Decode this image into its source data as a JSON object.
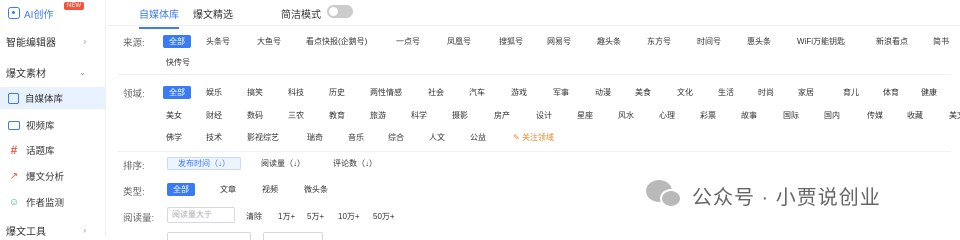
{
  "sidebar": {
    "top": {
      "label": "AI创作",
      "badge": "NEW"
    },
    "groups": [
      {
        "label": "智能编辑器"
      },
      {
        "label": "爆文素材"
      },
      {
        "label": "爆文工具"
      }
    ],
    "items": [
      {
        "label": "自媒体库",
        "icon": "media-library-icon",
        "active": true
      },
      {
        "label": "视频库",
        "icon": "video-icon"
      },
      {
        "label": "话题库",
        "icon": "hash-icon"
      },
      {
        "label": "爆文分析",
        "icon": "trend-chart-icon"
      },
      {
        "label": "作者监测",
        "icon": "user-add-icon"
      }
    ]
  },
  "tabs": [
    {
      "label": "自媒体库",
      "active": true
    },
    {
      "label": "爆文精选"
    }
  ],
  "simple_mode": {
    "label": "简洁模式",
    "on": false
  },
  "filters": {
    "source": {
      "label": "来源:",
      "row1": [
        "全部",
        "头条号",
        "大鱼号",
        "看点快报(企鹅号)",
        "一点号",
        "凤凰号",
        "搜狐号",
        "网易号",
        "趣头条",
        "东方号",
        "时间号",
        "惠头条",
        "WiFi万能钥匙",
        "新浪看点",
        "简书"
      ],
      "row2": [
        "快传号"
      ]
    },
    "domain": {
      "label": "领域:",
      "row1": [
        "全部",
        "娱乐",
        "搞笑",
        "科技",
        "历史",
        "两性情感",
        "社会",
        "汽车",
        "游戏",
        "军事",
        "动漫",
        "美食",
        "文化",
        "生活",
        "时尚",
        "家居",
        "育儿",
        "体育",
        "健康"
      ],
      "row2": [
        "美女",
        "财经",
        "数码",
        "三农",
        "教育",
        "旅游",
        "科学",
        "摄影",
        "房产",
        "设计",
        "星座",
        "风水",
        "心理",
        "彩票",
        "故事",
        "国际",
        "国内",
        "传媒",
        "收藏",
        "美文"
      ],
      "row3": [
        "佛学",
        "技术",
        "影视综艺",
        "瑞奇",
        "音乐",
        "综合",
        "人文",
        "公益"
      ],
      "follow": "关注领域"
    },
    "sort": {
      "label": "排序:",
      "options": [
        "发布时间（↓）",
        "阅读量（↓）",
        "评论数（↓）"
      ]
    },
    "type": {
      "label": "类型:",
      "options": [
        "全部",
        "文章",
        "视频",
        "微头条"
      ]
    },
    "reads": {
      "label": "阅读量:",
      "placeholder": "阅读量大于",
      "options": [
        "清除",
        "1万+",
        "5万+",
        "10万+",
        "50万+"
      ]
    }
  },
  "watermark": {
    "text": "公众号 · 小贾说创业"
  },
  "colors": {
    "accent": "#3a7af5",
    "active_bg": "#e8f1fe",
    "follow": "#e58a2d"
  }
}
